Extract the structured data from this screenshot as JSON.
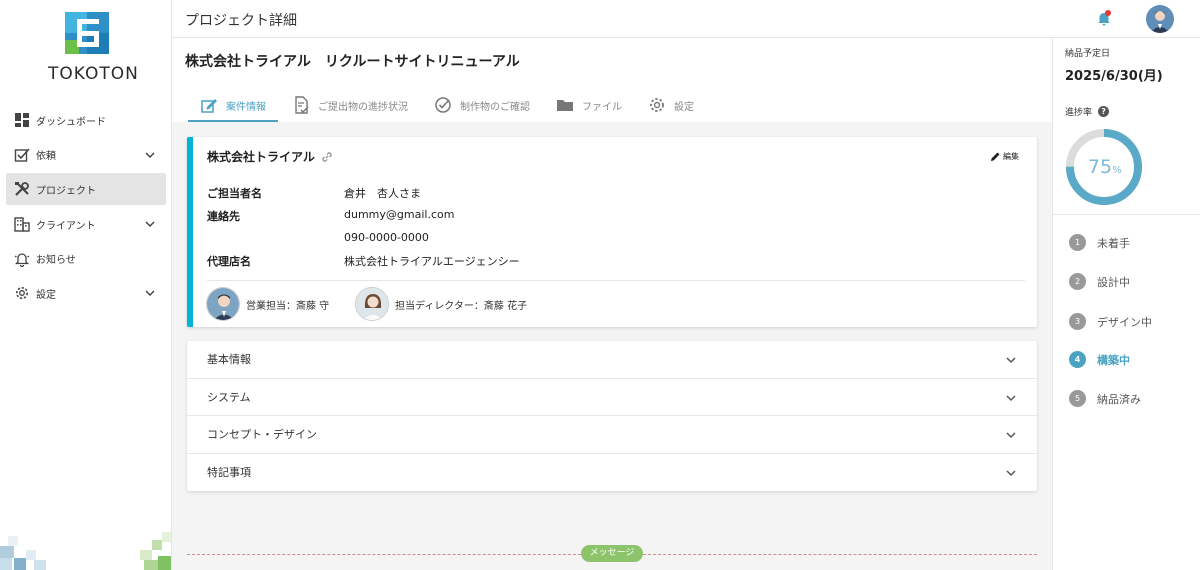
{
  "brand": {
    "name": "TOKOTON"
  },
  "sidebar": {
    "items": [
      {
        "label": "ダッシュボード",
        "icon": "dashboard-icon"
      },
      {
        "label": "依頼",
        "icon": "request-icon"
      },
      {
        "label": "プロジェクト",
        "icon": "tools-icon"
      },
      {
        "label": "クライアント",
        "icon": "building-icon"
      },
      {
        "label": "お知らせ",
        "icon": "bell-icon"
      },
      {
        "label": "設定",
        "icon": "gear-icon"
      }
    ]
  },
  "header": {
    "title": "プロジェクト詳細"
  },
  "project": {
    "title": "株式会社トライアル　リクルートサイトリニューアル",
    "tabs": [
      {
        "label": "案件情報",
        "icon": "edit-doc-icon"
      },
      {
        "label": "ご提出物の進捗状況",
        "icon": "doc-check-icon"
      },
      {
        "label": "制作物のご確認",
        "icon": "check-circle-icon"
      },
      {
        "label": "ファイル",
        "icon": "folder-icon"
      },
      {
        "label": "設定",
        "icon": "gear-icon"
      }
    ],
    "active_tab": "案件情報"
  },
  "client_card": {
    "company": "株式会社トライアル",
    "edit_label": "編集",
    "contact_label": "ご担当者名",
    "contact_name": "倉井　杏人さま",
    "info_label": "連絡先",
    "email": "dummy@gmail.com",
    "phone": "090-0000-0000",
    "agency_label": "代理店名",
    "agency": "株式会社トライアルエージェンシー",
    "sales": "営業担当：斎藤 守",
    "director": "担当ディレクター：斎藤 花子"
  },
  "accordion": [
    {
      "label": "基本情報"
    },
    {
      "label": "システム"
    },
    {
      "label": "コンセプト・デザイン"
    },
    {
      "label": "特記事項"
    }
  ],
  "message_label": "メッセージ",
  "right_panel": {
    "due_label": "納品予定日",
    "due_date": "2025/6/30(月)",
    "progress_label": "進捗率",
    "help": "?",
    "progress_value": "75",
    "progress_unit": "%",
    "progress_fraction": 0.75,
    "steps": [
      {
        "num": "1",
        "label": "未着手"
      },
      {
        "num": "2",
        "label": "設計中"
      },
      {
        "num": "3",
        "label": "デザイン中"
      },
      {
        "num": "4",
        "label": "構築中"
      },
      {
        "num": "5",
        "label": "納品済み"
      }
    ],
    "current_step": "構築中"
  },
  "colors": {
    "accent": "#4aa3c3",
    "card_border": "#00b4d8",
    "notification": "#e53935",
    "message": "#8dc46b"
  }
}
